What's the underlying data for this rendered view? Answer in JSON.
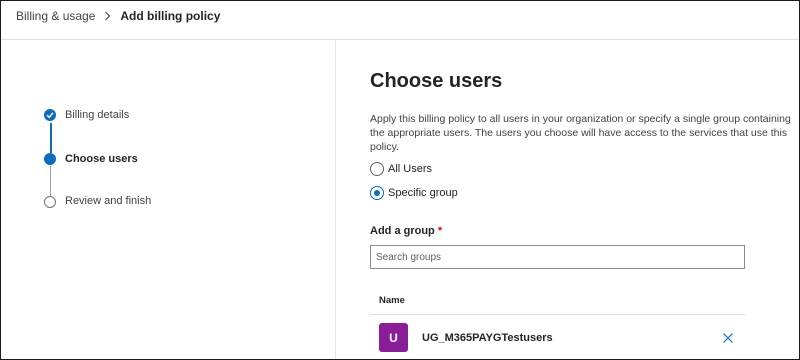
{
  "breadcrumb": {
    "parent": "Billing & usage",
    "current": "Add billing policy"
  },
  "stepper": {
    "steps": [
      {
        "label": "Billing details",
        "state": "completed"
      },
      {
        "label": "Choose users",
        "state": "current"
      },
      {
        "label": "Review and finish",
        "state": "pending"
      }
    ]
  },
  "main": {
    "title": "Choose users",
    "description": "Apply this billing policy to all users in your organization or specify a single group containing the appropriate users. The users you choose will have access to the services that use this policy.",
    "options": [
      {
        "label": "All Users",
        "selected": false
      },
      {
        "label": "Specific group",
        "selected": true
      }
    ],
    "add_group": {
      "label": "Add a group",
      "required_mark": "*",
      "search_placeholder": "Search groups",
      "search_value": ""
    },
    "table": {
      "column_name": "Name",
      "rows": [
        {
          "initial": "U",
          "name": "UG_M365PAYGTestusers"
        }
      ]
    }
  },
  "icons": {
    "breadcrumb_separator": "chevron-right-icon",
    "step_completed": "checkmark-icon",
    "remove": "dismiss-icon"
  },
  "colors": {
    "accent": "#0f6cbd",
    "avatar": "#8a1e96",
    "required": "#c50f1f"
  }
}
